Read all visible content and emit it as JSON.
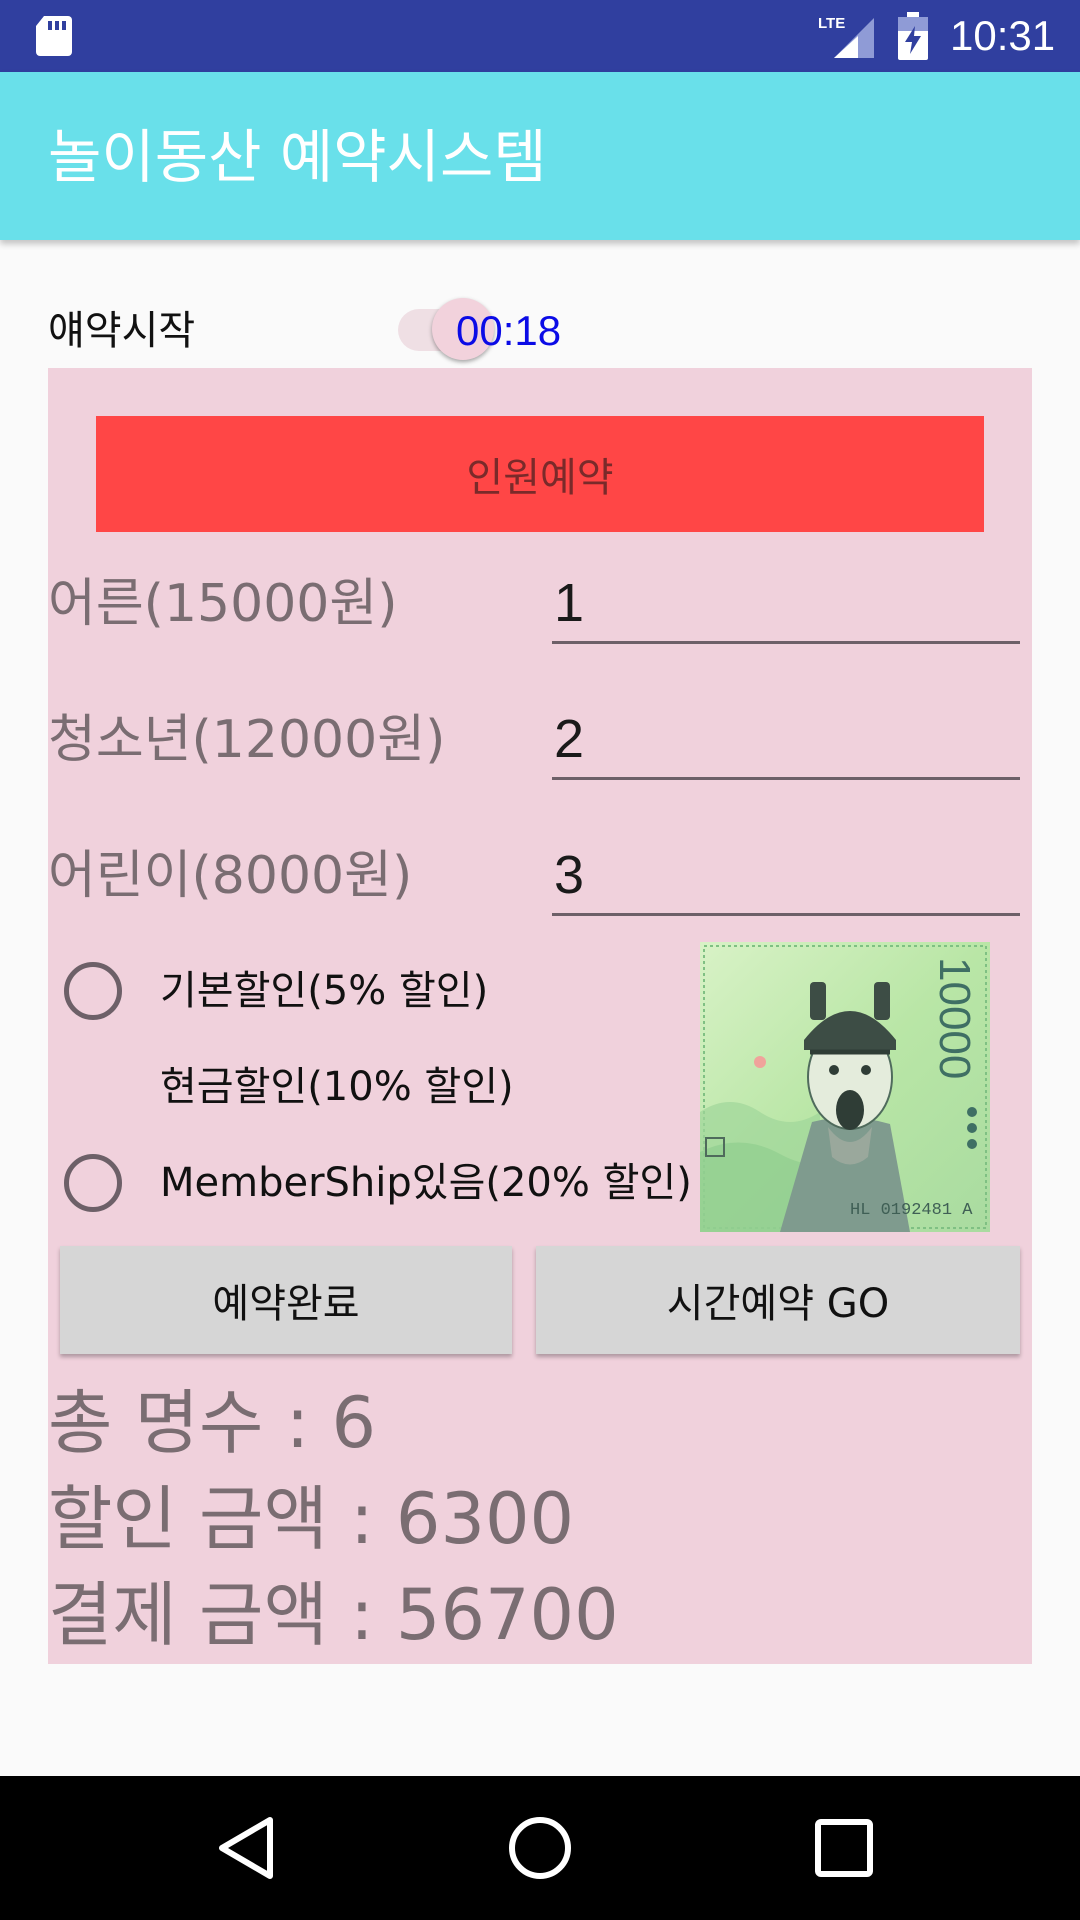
{
  "status_bar": {
    "time": "10:31",
    "network": "LTE",
    "icons": [
      "sd-card-icon",
      "lte-signal-icon",
      "battery-charging-icon"
    ]
  },
  "app_bar": {
    "title": "놀이동산 예약시스템",
    "color": "#69e0ea"
  },
  "reservation": {
    "start_label": "얘약시작",
    "timer": "00:18"
  },
  "panel": {
    "background": "#f0d1dc",
    "reserve_button_label": "인원예약",
    "persons": [
      {
        "label": "어른(15000원)",
        "value": "1"
      },
      {
        "label": "청소년(12000원)",
        "value": "2"
      },
      {
        "label": "어린이(8000원)",
        "value": "3"
      }
    ],
    "discounts": [
      {
        "label": "기본할인(5% 할인)",
        "has_radio": true
      },
      {
        "label": "현금할인(10% 할인)",
        "has_radio": false
      },
      {
        "label": "MemberShip있음(20% 할인)",
        "has_radio": true
      }
    ],
    "banknote": {
      "denomination": "10000",
      "serial": "HL 0192481 A"
    },
    "buttons": {
      "complete": "예약완료",
      "time_go": "시간예약 GO"
    },
    "summary": {
      "total_count": "총 명수 : 6",
      "discount_amount": "할인 금액 : 6300",
      "payment_amount": "결제 금액 : 56700"
    }
  },
  "nav_bar": {
    "icons": [
      "back-icon",
      "home-icon",
      "recents-icon"
    ]
  }
}
